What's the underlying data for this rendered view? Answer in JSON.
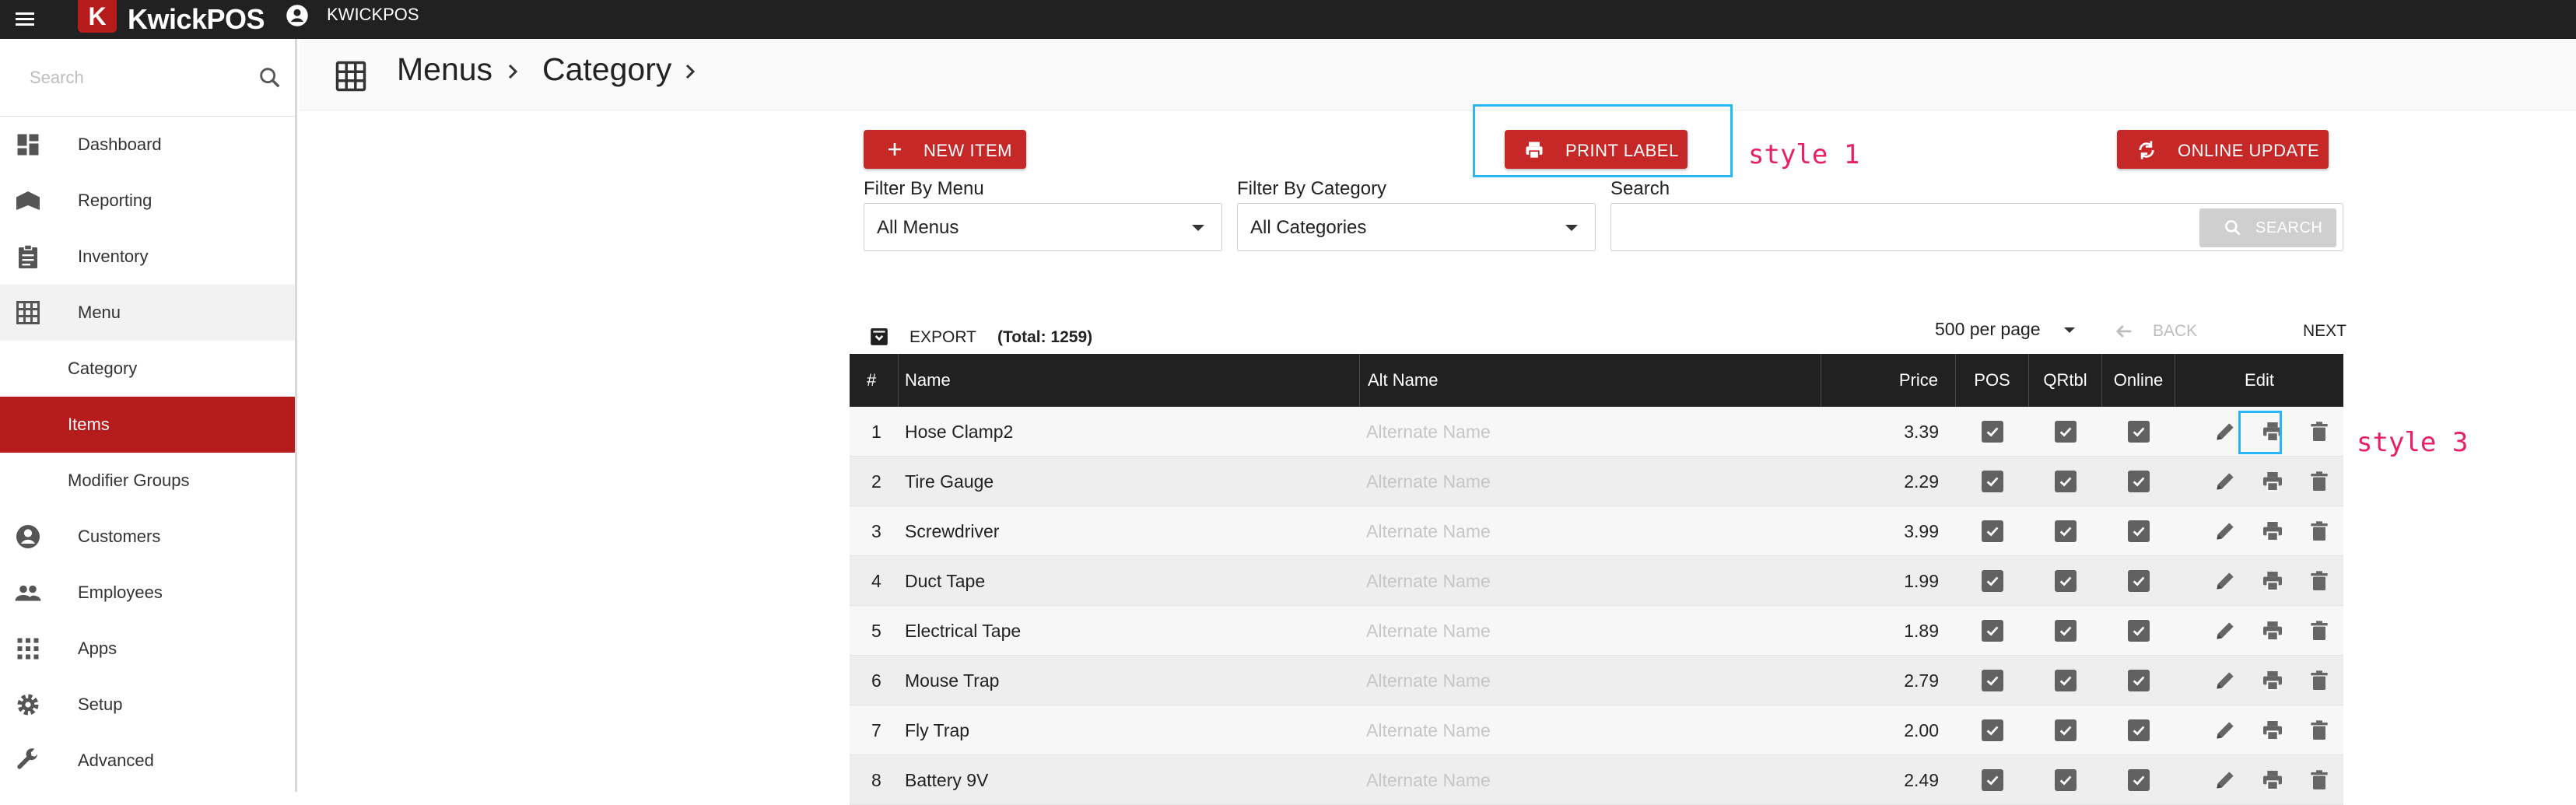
{
  "app": {
    "brand_letter": "K",
    "brand_name": "KwickPOS",
    "user_name": "KWICKPOS",
    "brand_color": "#b71c1c",
    "accent_highlight": "#29b6f6"
  },
  "sidebar": {
    "search_placeholder": "Search",
    "items": [
      {
        "label": "Dashboard",
        "icon": "dashboard-icon"
      },
      {
        "label": "Reporting",
        "icon": "reporting-icon"
      },
      {
        "label": "Inventory",
        "icon": "clipboard-icon"
      },
      {
        "label": "Menu",
        "icon": "grid-icon"
      },
      {
        "label": "Category",
        "icon": ""
      },
      {
        "label": "Items",
        "icon": ""
      },
      {
        "label": "Modifier Groups",
        "icon": ""
      },
      {
        "label": "Customers",
        "icon": "account-circle-icon"
      },
      {
        "label": "Employees",
        "icon": "people-icon"
      },
      {
        "label": "Apps",
        "icon": "apps-icon"
      },
      {
        "label": "Setup",
        "icon": "gear-icon"
      },
      {
        "label": "Advanced",
        "icon": "wrench-icon"
      }
    ],
    "active_item": "Items"
  },
  "breadcrumb": {
    "items": [
      "Menus",
      "Category"
    ]
  },
  "toolbar": {
    "new_item": "NEW ITEM",
    "print_label": "PRINT LABEL",
    "online_update": "ONLINE UPDATE"
  },
  "annotations": {
    "style1": "style 1",
    "style3": "style 3"
  },
  "filters": {
    "menu_label": "Filter By Menu",
    "menu_value": "All Menus",
    "category_label": "Filter By Category",
    "category_value": "All Categories",
    "search_label": "Search",
    "search_button": "SEARCH"
  },
  "table_tools": {
    "export": "EXPORT",
    "total": "(Total: 1259)",
    "per_page": "500 per page",
    "back": "BACK",
    "next": "NEXT"
  },
  "table": {
    "columns": [
      "#",
      "Name",
      "Alt Name",
      "Price",
      "POS",
      "QRtbl",
      "Online",
      "Edit"
    ],
    "rows": [
      {
        "num": "1",
        "name": "Hose Clamp2",
        "alt": "Alternate Name",
        "price": "3.39",
        "pos": true,
        "qrtbl": true,
        "online": true
      },
      {
        "num": "2",
        "name": "Tire Gauge",
        "alt": "Alternate Name",
        "price": "2.29",
        "pos": true,
        "qrtbl": true,
        "online": true
      },
      {
        "num": "3",
        "name": "Screwdriver",
        "alt": "Alternate Name",
        "price": "3.99",
        "pos": true,
        "qrtbl": true,
        "online": true
      },
      {
        "num": "4",
        "name": "Duct Tape",
        "alt": "Alternate Name",
        "price": "1.99",
        "pos": true,
        "qrtbl": true,
        "online": true
      },
      {
        "num": "5",
        "name": "Electrical Tape",
        "alt": "Alternate Name",
        "price": "1.89",
        "pos": true,
        "qrtbl": true,
        "online": true
      },
      {
        "num": "6",
        "name": "Mouse Trap",
        "alt": "Alternate Name",
        "price": "2.79",
        "pos": true,
        "qrtbl": true,
        "online": true
      },
      {
        "num": "7",
        "name": "Fly Trap",
        "alt": "Alternate Name",
        "price": "2.00",
        "pos": true,
        "qrtbl": true,
        "online": true
      },
      {
        "num": "8",
        "name": "Battery 9V",
        "alt": "Alternate Name",
        "price": "2.49",
        "pos": true,
        "qrtbl": true,
        "online": true
      }
    ]
  }
}
